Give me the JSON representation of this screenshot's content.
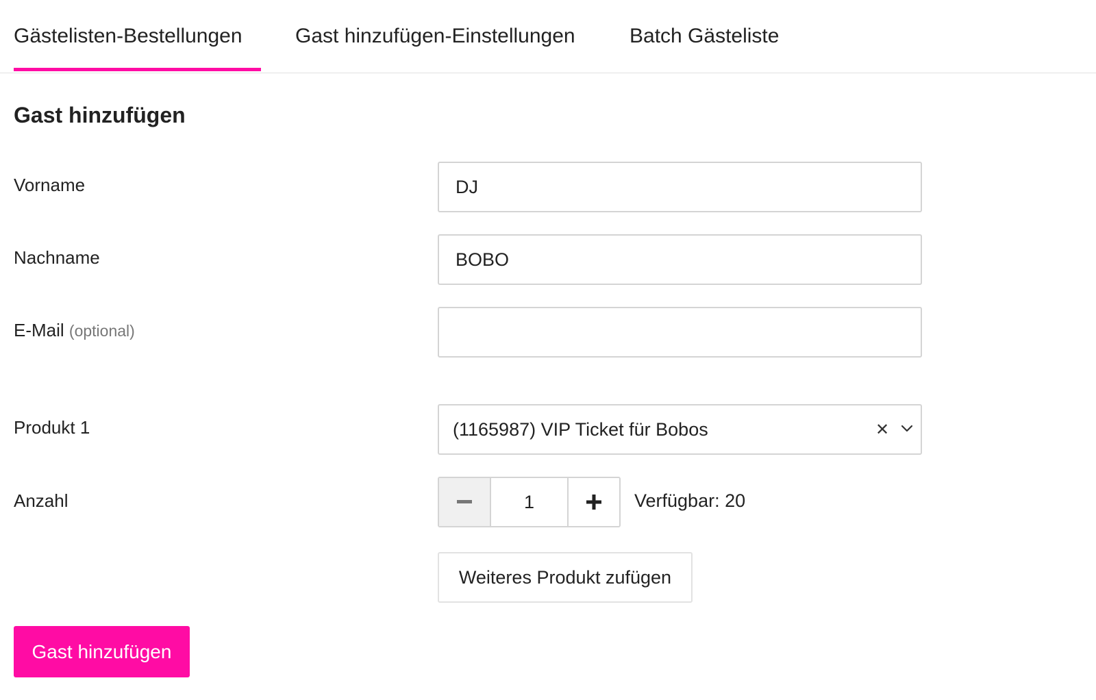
{
  "tabs": [
    {
      "label": "Gästelisten-Bestellungen",
      "active": true
    },
    {
      "label": "Gast hinzufügen-Einstellungen",
      "active": false
    },
    {
      "label": "Batch Gästeliste",
      "active": false
    }
  ],
  "colors": {
    "accent": "#ff0ca4",
    "border": "#d4d4d4",
    "text": "#222222",
    "muted": "#777777"
  },
  "form": {
    "title": "Gast hinzufügen",
    "first_name": {
      "label": "Vorname",
      "value": "DJ",
      "placeholder": ""
    },
    "last_name": {
      "label": "Nachname",
      "value": "BOBO",
      "placeholder": ""
    },
    "email": {
      "label": "E-Mail",
      "optional_label": "(optional)",
      "value": "",
      "placeholder": ""
    },
    "product": {
      "label": "Produkt 1",
      "selected": "(1165987) VIP Ticket für Bobos",
      "clear_icon": "close-icon",
      "dropdown_icon": "chevron-down-icon"
    },
    "quantity": {
      "label": "Anzahl",
      "value": "1",
      "available": "Verfügbar: 20",
      "minus_icon": "minus-icon",
      "plus_icon": "plus-icon"
    },
    "add_product_label": "Weiteres Produkt zufügen",
    "submit_label": "Gast hinzufügen"
  }
}
